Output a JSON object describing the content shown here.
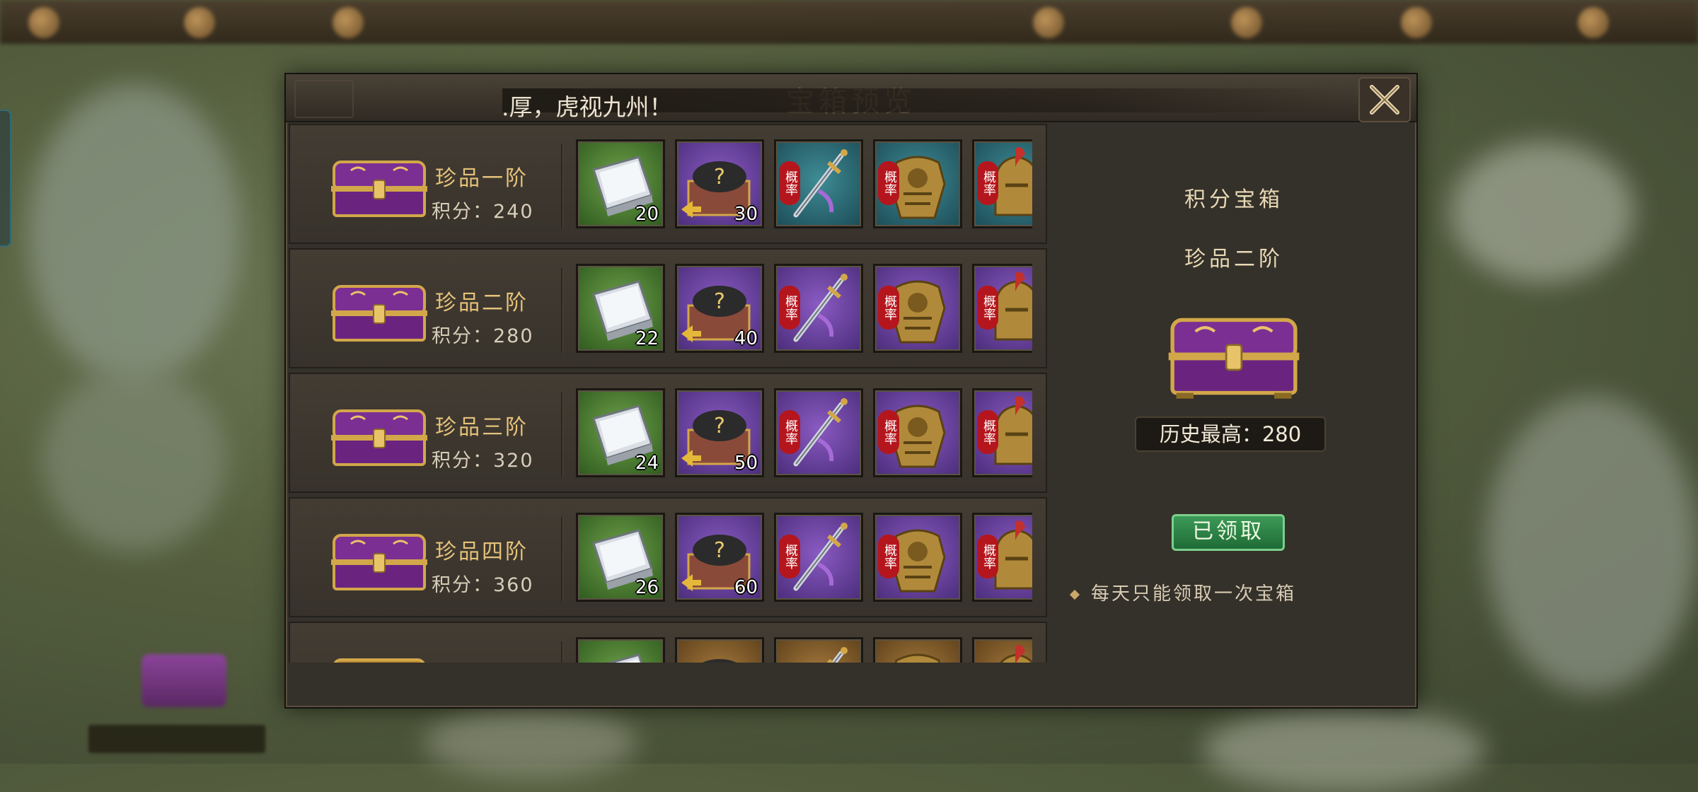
{
  "dialog": {
    "title": "宝箱预览",
    "marquee": ".厚，虎视九州！"
  },
  "tiers": [
    {
      "name": "珍品一阶",
      "score": "积分：240",
      "chest_color": "purple",
      "items": [
        {
          "icon": "silver-ingot-icon",
          "bg": "green",
          "count": "20",
          "prob": ""
        },
        {
          "icon": "mystery-ore-box-icon",
          "bg": "purple",
          "count": "30",
          "prob": ""
        },
        {
          "icon": "sword-icon",
          "bg": "teal",
          "count": "",
          "prob": "概率"
        },
        {
          "icon": "armor-icon",
          "bg": "teal",
          "count": "",
          "prob": "概率"
        },
        {
          "icon": "helmet-icon",
          "bg": "teal",
          "count": "",
          "prob": "概率"
        }
      ]
    },
    {
      "name": "珍品二阶",
      "score": "积分：280",
      "chest_color": "purple",
      "items": [
        {
          "icon": "silver-ingot-icon",
          "bg": "green",
          "count": "22",
          "prob": ""
        },
        {
          "icon": "mystery-ore-box-icon",
          "bg": "purple",
          "count": "40",
          "prob": ""
        },
        {
          "icon": "sword-icon",
          "bg": "purple",
          "count": "",
          "prob": "概率"
        },
        {
          "icon": "armor-icon",
          "bg": "purple",
          "count": "",
          "prob": "概率"
        },
        {
          "icon": "helmet-icon",
          "bg": "purple",
          "count": "",
          "prob": "概率"
        }
      ]
    },
    {
      "name": "珍品三阶",
      "score": "积分：320",
      "chest_color": "purple",
      "items": [
        {
          "icon": "silver-ingot-icon",
          "bg": "green",
          "count": "24",
          "prob": ""
        },
        {
          "icon": "mystery-ore-box-icon",
          "bg": "purple",
          "count": "50",
          "prob": ""
        },
        {
          "icon": "sword-icon",
          "bg": "purple",
          "count": "",
          "prob": "概率"
        },
        {
          "icon": "armor-icon",
          "bg": "purple",
          "count": "",
          "prob": "概率"
        },
        {
          "icon": "helmet-icon",
          "bg": "purple",
          "count": "",
          "prob": "概率"
        }
      ]
    },
    {
      "name": "珍品四阶",
      "score": "积分：360",
      "chest_color": "purple",
      "items": [
        {
          "icon": "silver-ingot-icon",
          "bg": "green",
          "count": "26",
          "prob": ""
        },
        {
          "icon": "mystery-ore-box-icon",
          "bg": "purple",
          "count": "60",
          "prob": ""
        },
        {
          "icon": "sword-icon",
          "bg": "purple",
          "count": "",
          "prob": "概率"
        },
        {
          "icon": "armor-icon",
          "bg": "purple",
          "count": "",
          "prob": "概率"
        },
        {
          "icon": "helmet-icon",
          "bg": "purple",
          "count": "",
          "prob": "概率"
        }
      ]
    },
    {
      "name": "",
      "score": "",
      "chest_color": "gold",
      "items": [
        {
          "icon": "silver-ingot-icon",
          "bg": "green",
          "count": "",
          "prob": ""
        },
        {
          "icon": "mystery-ore-box-icon",
          "bg": "gold",
          "count": "",
          "prob": ""
        },
        {
          "icon": "sword-icon",
          "bg": "gold",
          "count": "",
          "prob": ""
        },
        {
          "icon": "armor-icon",
          "bg": "gold",
          "count": "",
          "prob": ""
        },
        {
          "icon": "helmet-icon",
          "bg": "gold",
          "count": "",
          "prob": ""
        }
      ]
    }
  ],
  "side": {
    "title": "积分宝箱",
    "tier": "珍品二阶",
    "history": "历史最高：280",
    "claimed_label": "已领取",
    "note": "每天只能领取一次宝箱"
  },
  "colors": {
    "purple_chest": "#7b2f93",
    "gold_trim": "#d2a74a",
    "claimed_green": "#2f8a4a"
  }
}
